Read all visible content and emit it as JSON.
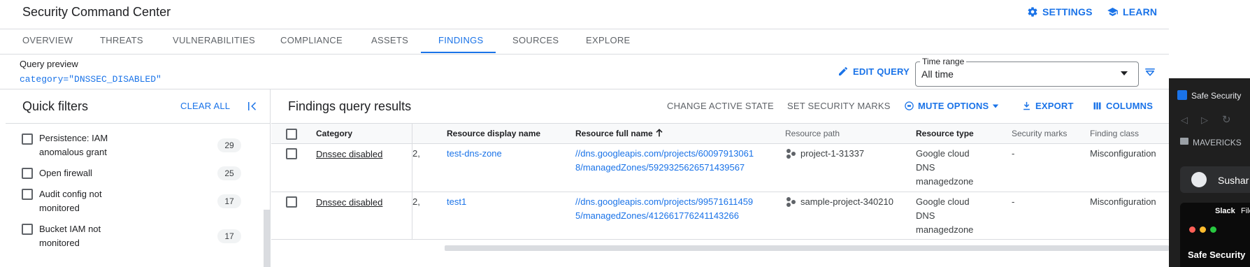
{
  "app": {
    "title": "Security Command Center",
    "settings_label": "SETTINGS",
    "learn_label": "LEARN"
  },
  "tabs": [
    {
      "label": "OVERVIEW"
    },
    {
      "label": "THREATS"
    },
    {
      "label": "VULNERABILITIES"
    },
    {
      "label": "COMPLIANCE"
    },
    {
      "label": "ASSETS"
    },
    {
      "label": "FINDINGS",
      "active": true
    },
    {
      "label": "SOURCES"
    },
    {
      "label": "EXPLORE"
    }
  ],
  "query": {
    "preview_label": "Query preview",
    "preview_value": "category=\"DNSSEC_DISABLED\"",
    "edit_label": "EDIT QUERY",
    "time_range_label": "Time range",
    "time_range_value": "All time"
  },
  "quick_filters": {
    "title": "Quick filters",
    "clear_all": "CLEAR ALL",
    "items": [
      {
        "label": "Persistence: IAM anomalous grant",
        "count": "29"
      },
      {
        "label": "Open firewall",
        "count": "25"
      },
      {
        "label": "Audit config not monitored",
        "count": "17"
      },
      {
        "label": "Bucket IAM not monitored",
        "count": "17"
      }
    ]
  },
  "results": {
    "title": "Findings query results",
    "actions": {
      "change_state": "CHANGE ACTIVE STATE",
      "set_marks": "SET SECURITY MARKS",
      "mute": "MUTE OPTIONS",
      "export": "EXPORT",
      "columns": "COLUMNS"
    },
    "columns": {
      "category": "Category",
      "display_name": "Resource display name",
      "full_name": "Resource full name",
      "path": "Resource path",
      "type": "Resource type",
      "marks": "Security marks",
      "class": "Finding class"
    },
    "rows": [
      {
        "category": "Dnssec disabled",
        "clipped": "2,",
        "display_name": "test-dns-zone",
        "full_name_1": "//dns.googleapis.com/projects/60097913061",
        "full_name_2": "8/managedZones/5929325626571439567",
        "path": "project-1-31337",
        "type_1": "Google cloud",
        "type_2": "DNS",
        "type_3": "managedzone",
        "marks": "-",
        "class": "Misconfiguration"
      },
      {
        "category": "Dnssec disabled",
        "clipped": "2,",
        "display_name": "test1",
        "full_name_1": "//dns.googleapis.com/projects/99571611459",
        "full_name_2": "5/managedZones/412661776241143266",
        "path": "sample-project-340210",
        "type_1": "Google cloud",
        "type_2": "DNS",
        "type_3": "managedzone",
        "marks": "-",
        "class": "Misconfiguration"
      }
    ]
  },
  "overlay": {
    "window_title": "Safe Security",
    "folder": "MAVERICKS",
    "user": "Sushar",
    "slack": "Slack",
    "file": "File",
    "app_name": "Safe Security"
  },
  "colors": {
    "accent": "#1a73e8",
    "border": "#dadce0",
    "text": "#202124",
    "muted": "#5f6368"
  }
}
